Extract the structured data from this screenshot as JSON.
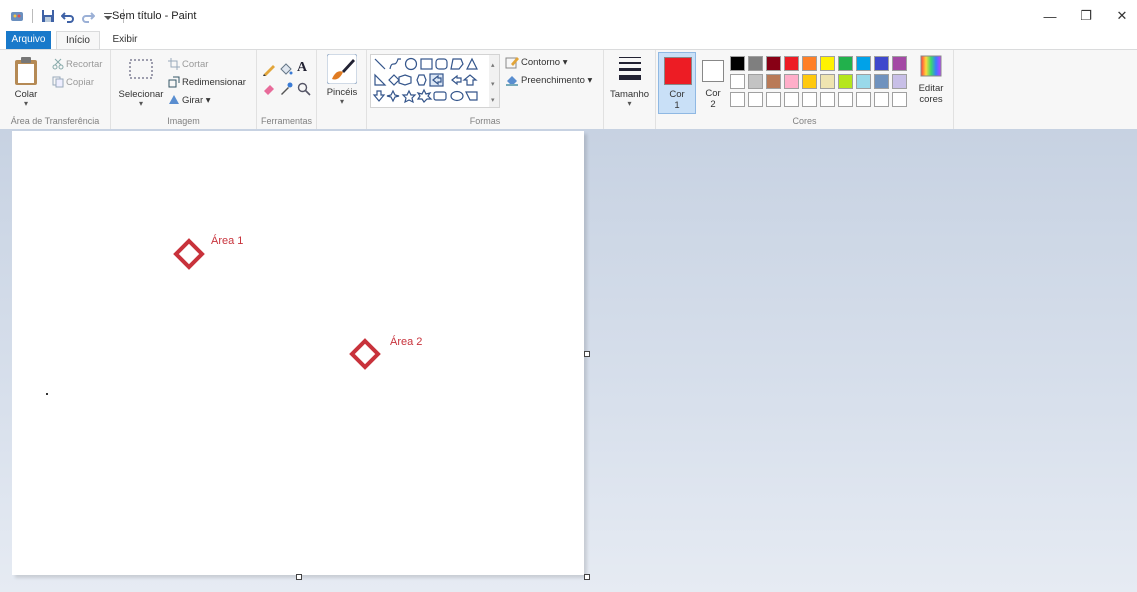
{
  "window": {
    "title": "Sem título - Paint"
  },
  "quick_access": [
    "paint-app-icon",
    "save-icon",
    "undo-icon",
    "redo-icon",
    "customize-qat-icon"
  ],
  "window_controls": {
    "minimize": "—",
    "restore": "❐",
    "close": "✕"
  },
  "tabs": {
    "file": "Arquivo",
    "home": "Início",
    "view": "Exibir"
  },
  "ribbon": {
    "clipboard": {
      "paste": "Colar",
      "cut": "Recortar",
      "copy": "Copiar",
      "label": "Área de Transferência"
    },
    "image": {
      "select": "Selecionar",
      "crop": "Cortar",
      "resize": "Redimensionar",
      "rotate": "Girar ▾",
      "label": "Imagem"
    },
    "tools": {
      "label": "Ferramentas"
    },
    "brushes": {
      "label": "Pincéis"
    },
    "shapes": {
      "outline": "Contorno ▾",
      "fill": "Preenchimento ▾",
      "label": "Formas"
    },
    "size": {
      "label": "Tamanho"
    },
    "colors": {
      "color1_line1": "Cor",
      "color1_line2": "1",
      "color2_line1": "Cor",
      "color2_line2": "2",
      "edit_line1": "Editar",
      "edit_line2": "cores",
      "label": "Cores",
      "color1": "#ed1c24",
      "color2": "#ffffff",
      "row1": [
        "#000000",
        "#7f7f7f",
        "#880015",
        "#ed1c24",
        "#ff7f27",
        "#fff200",
        "#22b14c",
        "#00a2e8",
        "#3f48cc",
        "#a349a4"
      ],
      "row2": [
        "#ffffff",
        "#c3c3c3",
        "#b97a57",
        "#ffaec9",
        "#ffc90e",
        "#efe4b0",
        "#b5e61d",
        "#99d9ea",
        "#7092be",
        "#c8bfe7"
      ]
    }
  },
  "canvas": {
    "labels": {
      "area1": "Área 1",
      "area2": "Área 2"
    },
    "diamond_color": "#c8323b"
  }
}
